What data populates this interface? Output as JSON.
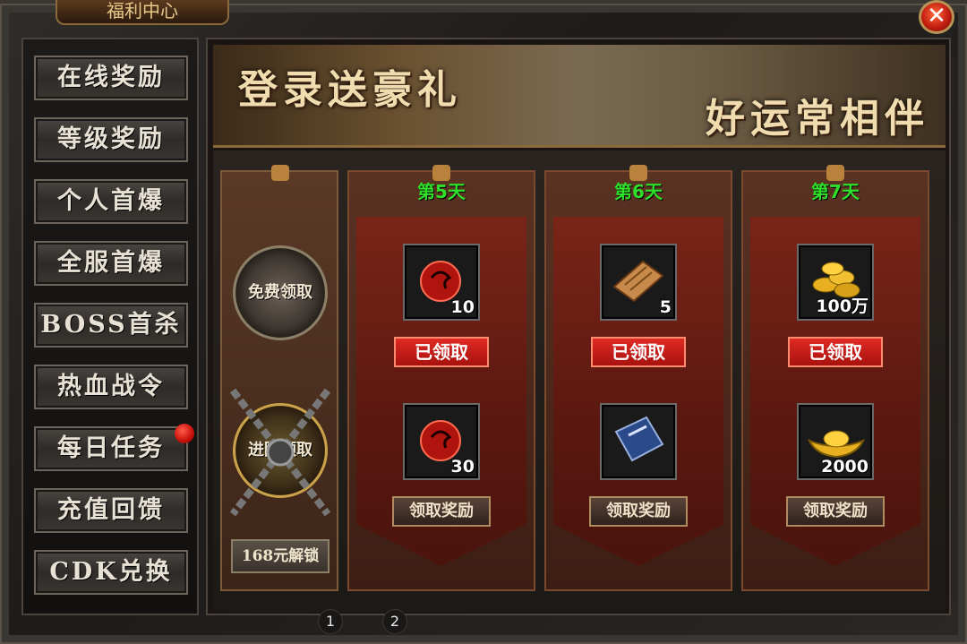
{
  "window": {
    "title": "福利中心",
    "close_label": "✕"
  },
  "sidebar": {
    "items": [
      {
        "label": "在线奖励"
      },
      {
        "label": "等级奖励"
      },
      {
        "label": "个人首爆"
      },
      {
        "label": "全服首爆"
      },
      {
        "label": "BOSS首杀"
      },
      {
        "label": "热血战令"
      },
      {
        "label": "每日任务"
      },
      {
        "label": "充值回馈"
      },
      {
        "label": "CDK兑换"
      }
    ]
  },
  "banner": {
    "title_left": "登录送豪礼",
    "title_right": "好运常相伴"
  },
  "left_panel": {
    "free_claim": "免费领取",
    "advanced_claim": "进阶领取",
    "unlock_button": "168元解锁"
  },
  "days": [
    {
      "label": "第5天",
      "free_reward": {
        "icon": "red-dragon-orb-icon",
        "qty": "10"
      },
      "free_status": "已领取",
      "paid_reward": {
        "icon": "red-dragon-orb-icon",
        "qty": "30"
      },
      "paid_button": "领取奖励"
    },
    {
      "label": "第6天",
      "free_reward": {
        "icon": "scroll-icon",
        "qty": "5"
      },
      "free_status": "已领取",
      "paid_reward": {
        "icon": "blue-book-icon",
        "qty": ""
      },
      "paid_button": "领取奖励"
    },
    {
      "label": "第7天",
      "free_reward": {
        "icon": "gold-coins-icon",
        "qty": "100万"
      },
      "free_status": "已领取",
      "paid_reward": {
        "icon": "gold-ingot-icon",
        "qty": "2000"
      },
      "paid_button": "领取奖励"
    }
  ],
  "pagination": {
    "pages": [
      "1",
      "2"
    ]
  },
  "colors": {
    "day_label": "#2fe02a",
    "claimed_bg": "#d0201a",
    "accent_gold": "#c9a24a"
  }
}
